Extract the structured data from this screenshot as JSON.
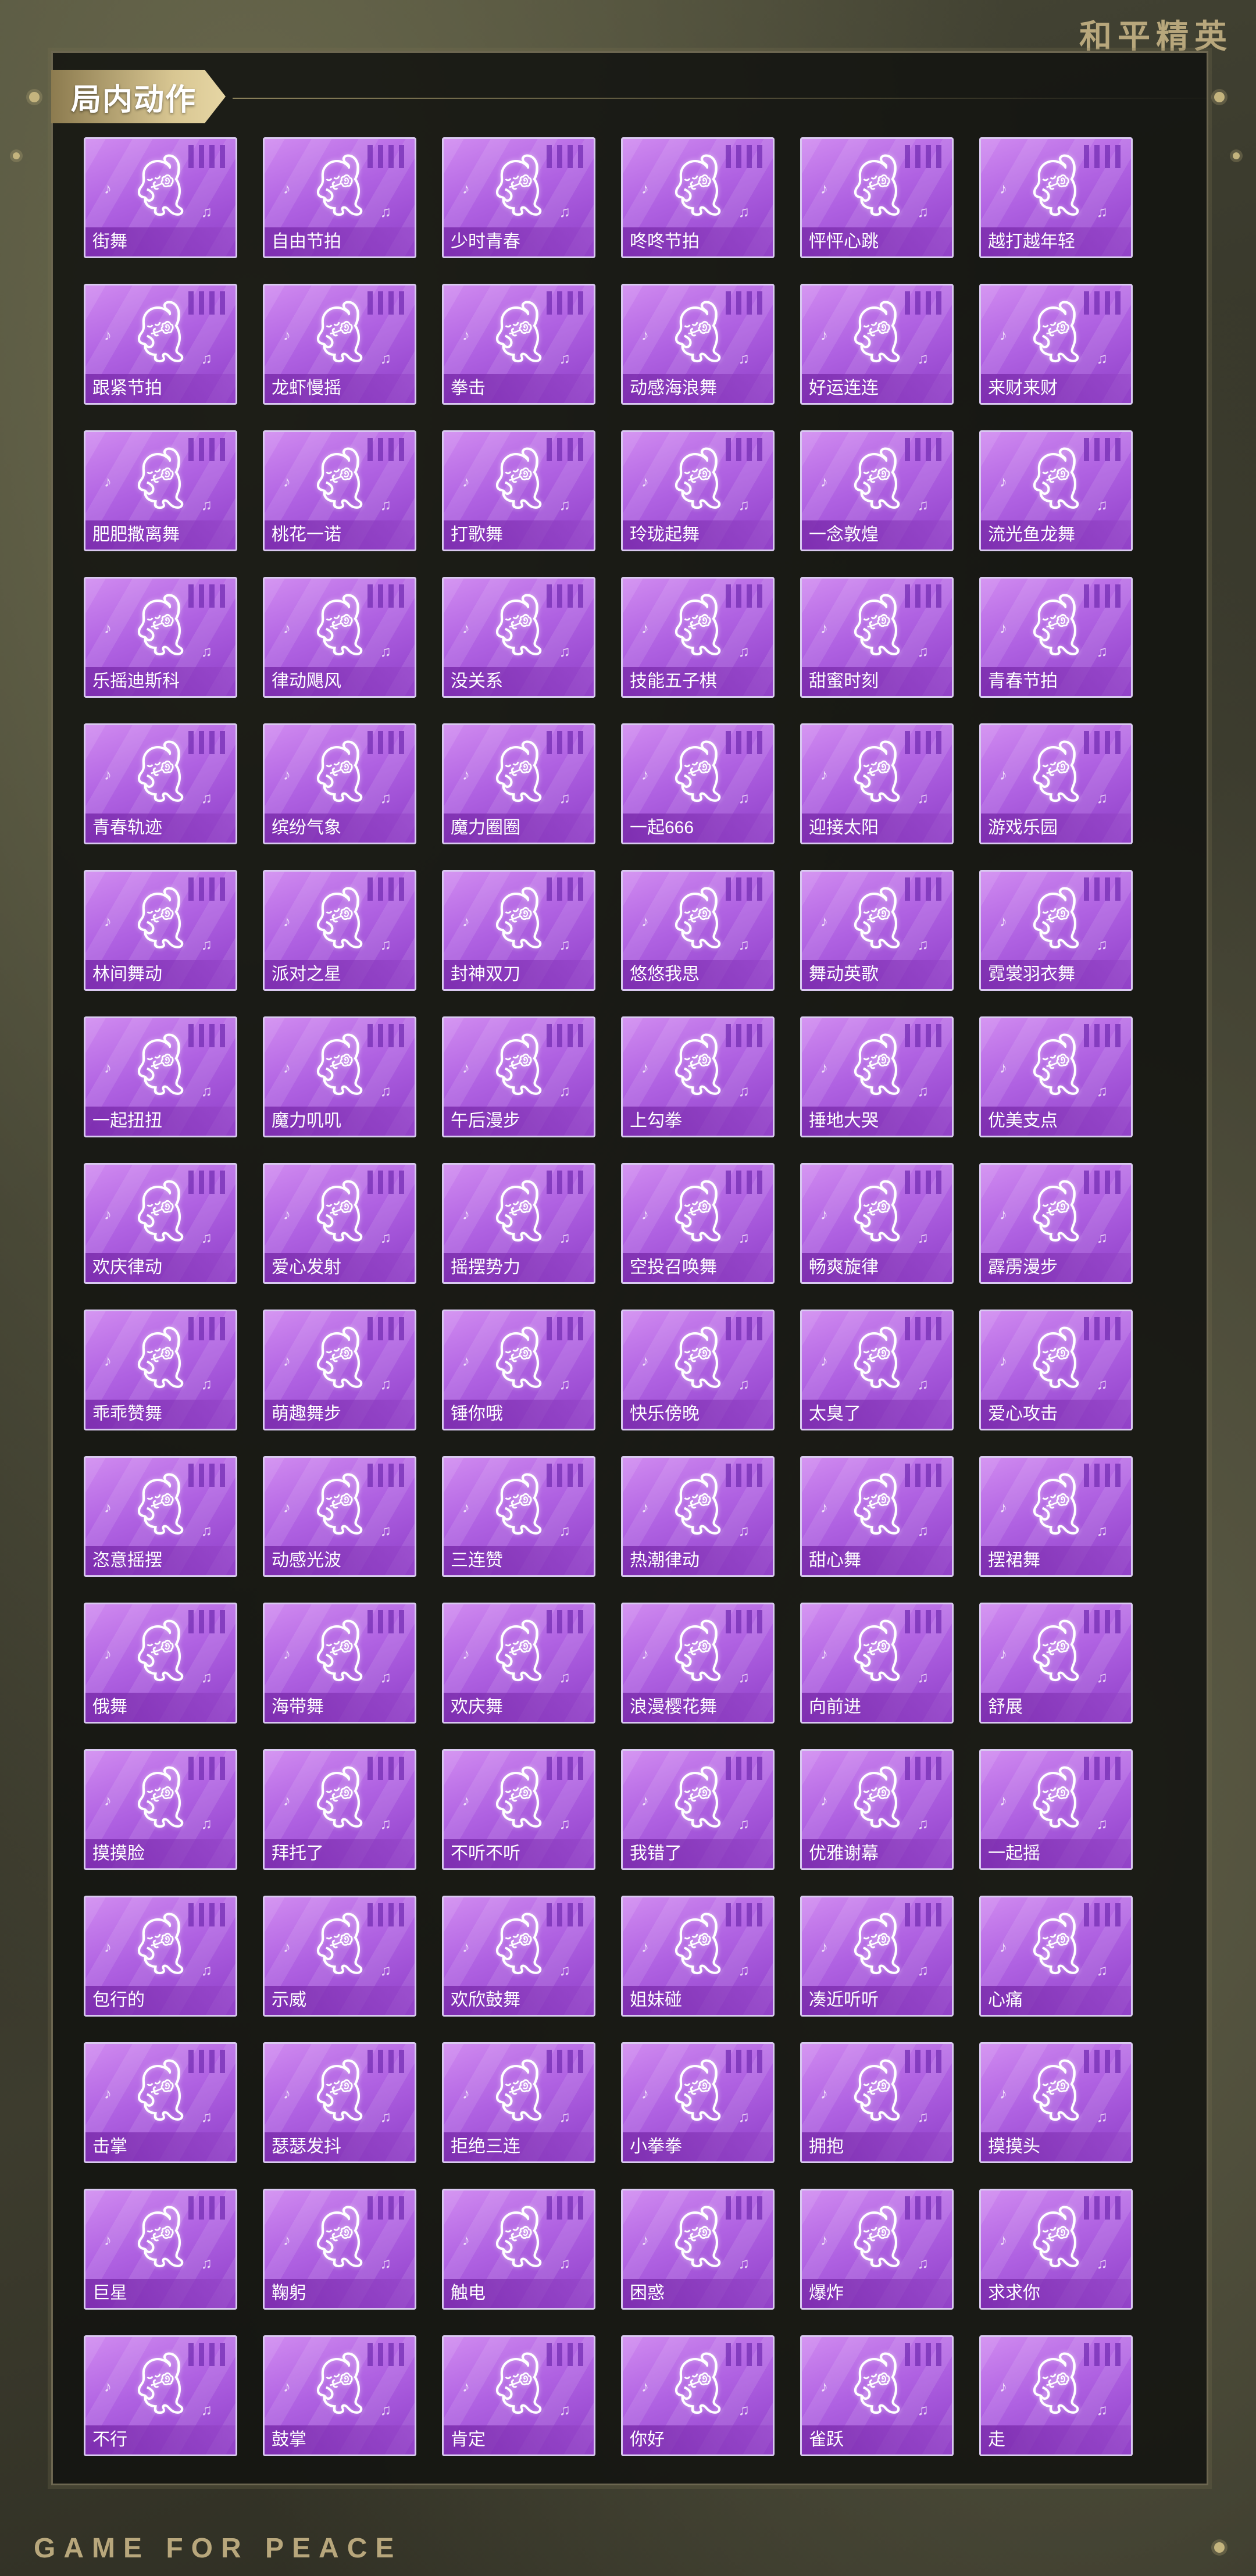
{
  "brand": "和平精英",
  "section_title": "局内动作",
  "footer_brand": "GAME FOR PEACE",
  "colors": {
    "card_purple": "#b062e2",
    "gold": "#c4b47e",
    "frame_dark": "#121310"
  },
  "emotes": [
    "街舞",
    "自由节拍",
    "少时青春",
    "咚咚节拍",
    "怦怦心跳",
    "越打越年轻",
    "跟紧节拍",
    "龙虾慢摇",
    "拳击",
    "动感海浪舞",
    "好运连连",
    "来财来财",
    "肥肥撒离舞",
    "桃花一诺",
    "打歌舞",
    "玲珑起舞",
    "一念敦煌",
    "流光鱼龙舞",
    "乐摇迪斯科",
    "律动飓风",
    "没关系",
    "技能五子棋",
    "甜蜜时刻",
    "青春节拍",
    "青春轨迹",
    "缤纷气象",
    "魔力圈圈",
    "一起666",
    "迎接太阳",
    "游戏乐园",
    "林间舞动",
    "派对之星",
    "封神双刀",
    "悠悠我思",
    "舞动英歌",
    "霓裳羽衣舞",
    "一起扭扭",
    "魔力叽叽",
    "午后漫步",
    "上勾拳",
    "捶地大哭",
    "优美支点",
    "欢庆律动",
    "爱心发射",
    "摇摆势力",
    "空投召唤舞",
    "畅爽旋律",
    "霹雳漫步",
    "乖乖赞舞",
    "萌趣舞步",
    "锤你哦",
    "快乐傍晚",
    "太臭了",
    "爱心攻击",
    "恣意摇摆",
    "动感光波",
    "三连赞",
    "热潮律动",
    "甜心舞",
    "摆裙舞",
    "俄舞",
    "海带舞",
    "欢庆舞",
    "浪漫樱花舞",
    "向前进",
    "舒展",
    "摸摸脸",
    "拜托了",
    "不听不听",
    "我错了",
    "优雅谢幕",
    "一起摇",
    "包行的",
    "示威",
    "欢欣鼓舞",
    "姐妹碰",
    "凑近听听",
    "心痛",
    "击掌",
    "瑟瑟发抖",
    "拒绝三连",
    "小拳拳",
    "拥抱",
    "摸摸头",
    "巨星",
    "鞠躬",
    "触电",
    "困惑",
    "爆炸",
    "求求你",
    "不行",
    "鼓掌",
    "肯定",
    "你好",
    "雀跃",
    "走"
  ]
}
